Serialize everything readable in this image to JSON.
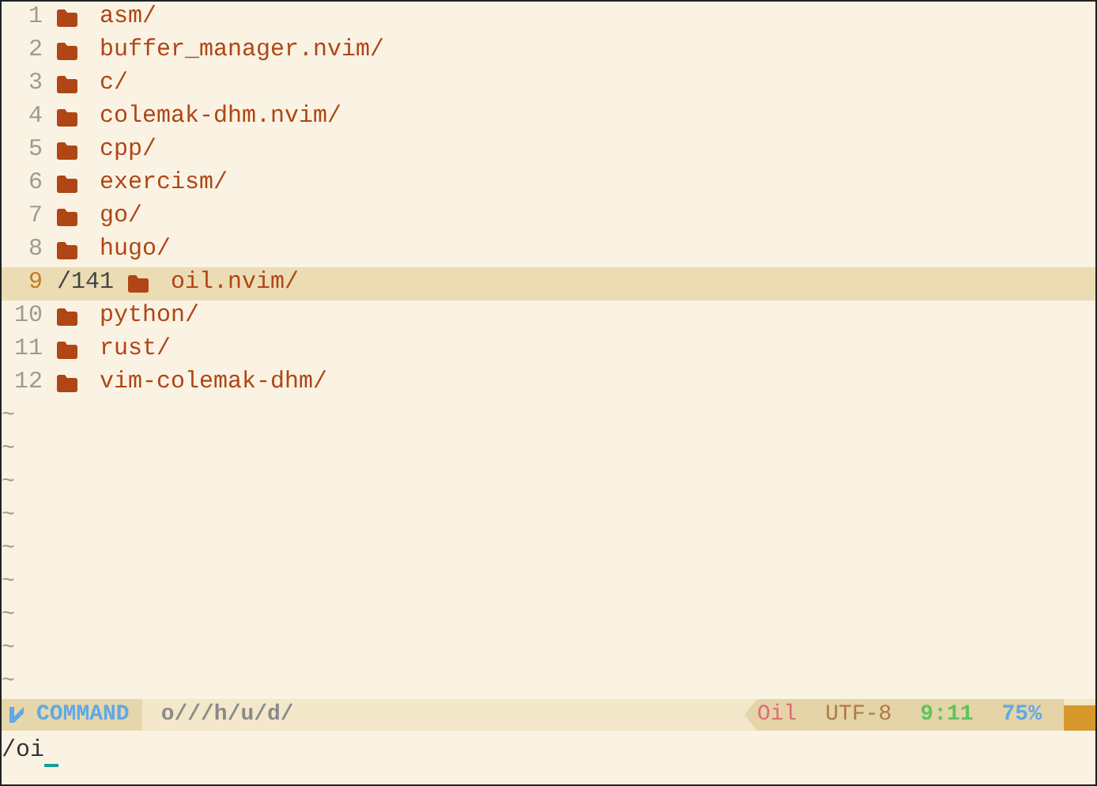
{
  "entries": [
    {
      "line": "1",
      "name": "asm/",
      "selected": false
    },
    {
      "line": "2",
      "name": "buffer_manager.nvim/",
      "selected": false
    },
    {
      "line": "3",
      "name": "c/",
      "selected": false
    },
    {
      "line": "4",
      "name": "colemak-dhm.nvim/",
      "selected": false
    },
    {
      "line": "5",
      "name": "cpp/",
      "selected": false
    },
    {
      "line": "6",
      "name": "exercism/",
      "selected": false
    },
    {
      "line": "7",
      "name": "go/",
      "selected": false
    },
    {
      "line": "8",
      "name": "hugo/",
      "selected": false
    },
    {
      "line": "9",
      "name": "oil.nvim/",
      "selected": true,
      "search_count": "/141"
    },
    {
      "line": "10",
      "name": "python/",
      "selected": false
    },
    {
      "line": "11",
      "name": "rust/",
      "selected": false
    },
    {
      "line": "12",
      "name": "vim-colemak-dhm/",
      "selected": false
    }
  ],
  "filler_lines": [
    "~",
    "~",
    "~",
    "~",
    "~",
    "~",
    "~",
    "~",
    "~"
  ],
  "status_line": {
    "mode": "COMMAND",
    "path": "o///h/u/d/",
    "filetype": "Oil",
    "encoding": "UTF-8",
    "position": "9:11",
    "progress": "75%"
  },
  "command_line": {
    "value": "/oi"
  }
}
